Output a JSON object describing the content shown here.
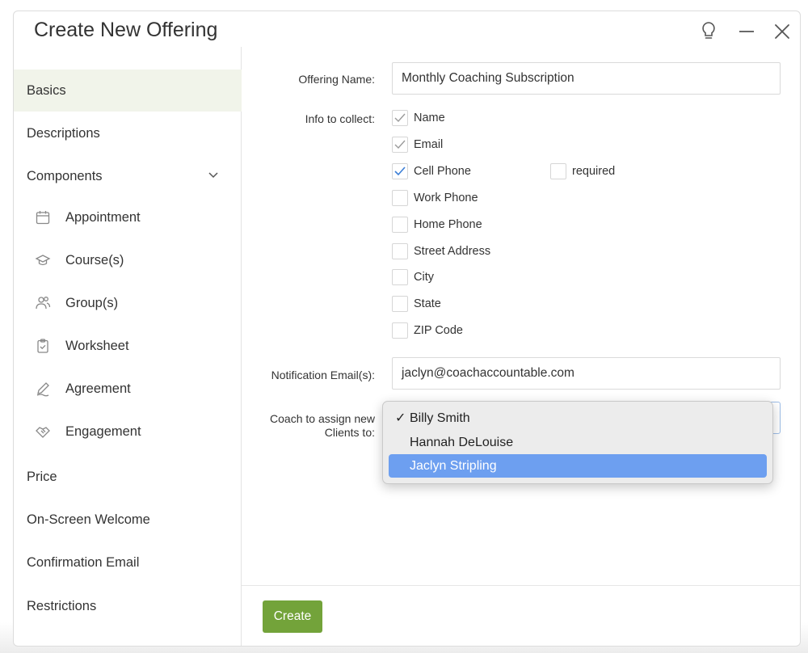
{
  "dialog": {
    "title": "Create New Offering",
    "controls": [
      "lightbulb-icon",
      "minimize-icon",
      "close-icon"
    ]
  },
  "sidebar": {
    "items": [
      {
        "label": "Basics",
        "active": true
      },
      {
        "label": "Descriptions"
      },
      {
        "label": "Components",
        "expanded": true
      },
      {
        "label": "Appointment",
        "icon": "calendar-icon"
      },
      {
        "label": "Course(s)",
        "icon": "graduation-cap-icon"
      },
      {
        "label": "Group(s)",
        "icon": "group-icon"
      },
      {
        "label": "Worksheet",
        "icon": "clipboard-check-icon"
      },
      {
        "label": "Agreement",
        "icon": "pen-icon"
      },
      {
        "label": "Engagement",
        "icon": "handshake-icon"
      },
      {
        "label": "Price"
      },
      {
        "label": "On-Screen Welcome"
      },
      {
        "label": "Confirmation Email"
      },
      {
        "label": "Restrictions"
      }
    ]
  },
  "form": {
    "offering_name_label": "Offering Name:",
    "offering_name_value": "Monthly Coaching Subscription",
    "info_label": "Info to collect:",
    "info_fields": [
      {
        "label": "Name",
        "checked": true,
        "disabled": true
      },
      {
        "label": "Email",
        "checked": true,
        "disabled": true
      },
      {
        "label": "Cell Phone",
        "checked": true
      },
      {
        "label": "Work Phone",
        "checked": false
      },
      {
        "label": "Home Phone",
        "checked": false
      },
      {
        "label": "Street Address",
        "checked": false
      },
      {
        "label": "City",
        "checked": false
      },
      {
        "label": "State",
        "checked": false
      },
      {
        "label": "ZIP Code",
        "checked": false
      }
    ],
    "required_label": "required",
    "required_checked": false,
    "notification_label": "Notification Email(s):",
    "notification_value": "jaclyn@coachaccountable.com",
    "coach_label_line1": "Coach to assign new",
    "coach_label_line2": "Clients to:",
    "coach_options": [
      {
        "label": "Billy Smith",
        "checked": true
      },
      {
        "label": "Hannah DeLouise"
      },
      {
        "label": "Jaclyn Stripling",
        "highlighted": true
      }
    ]
  },
  "footer": {
    "create_label": "Create"
  },
  "colors": {
    "accent_green": "#73a33a",
    "active_bg": "#f1f4ea",
    "checkmark_blue": "#3c7fd6",
    "menu_highlight": "#6d9ff0"
  }
}
